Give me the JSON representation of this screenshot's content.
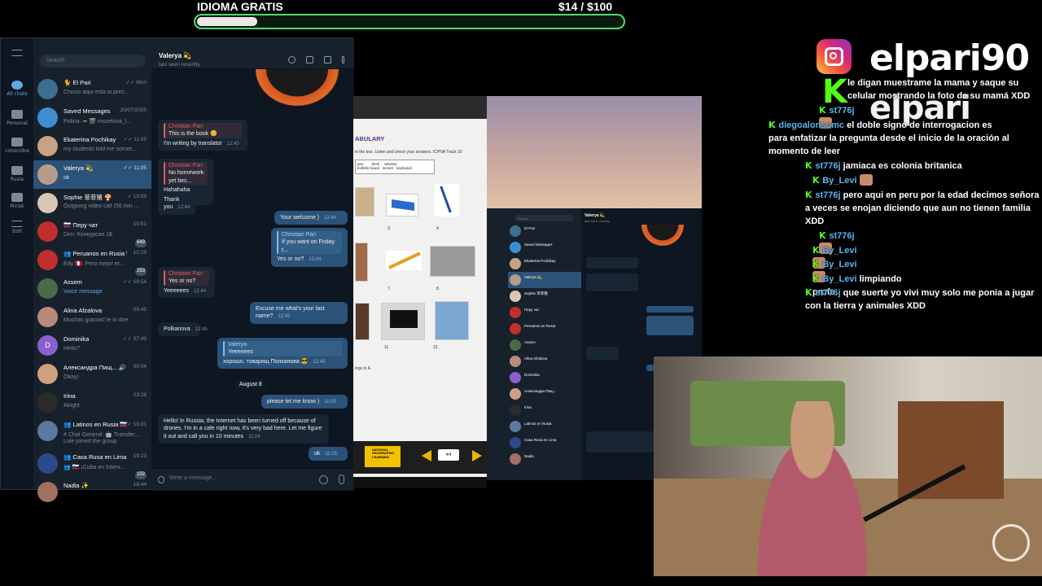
{
  "goal": {
    "title": "IDIOMA GRATIS",
    "amount": "$14  /  $100",
    "progress": 0.14,
    "accent": "#4ee06a"
  },
  "telegram": {
    "rail": [
      {
        "label": "All chats",
        "badge": "17"
      },
      {
        "label": "Personal"
      },
      {
        "label": "conocidos"
      },
      {
        "label": "Rusia"
      },
      {
        "label": "Minsk"
      },
      {
        "label": "Edit"
      }
    ],
    "search_placeholder": "Search",
    "chats": [
      {
        "name": "🐈 El Pari",
        "time": "✓✓ Mon",
        "preview": "Chicos aqui está la prim...",
        "color": "#3b6e8f"
      },
      {
        "name": "Saved Messages",
        "time": "20/07/2025",
        "preview": "Polina: ➡ 🎬 mozelova_l...",
        "color": "#3d8ed0"
      },
      {
        "name": "Ekaterina Pochikay",
        "time": "✓✓ 11:05",
        "preview": "my students told me somet...",
        "color": "#c9a184"
      },
      {
        "name": "Valerya 💫",
        "time": "✓✓ 11:05",
        "preview": "ok",
        "color": "#b89c8a"
      },
      {
        "name": "Sophie 菲菲猪 🍄",
        "time": "✓ 10:59",
        "preview": "Outgoing video call (56 min ...",
        "color": "#d8c6b6"
      },
      {
        "name": "🇷🇺 Перу чат",
        "time": "10:51",
        "preview": "Den: Конкурсия 1$",
        "badge": "649",
        "color": "#c22e2e"
      },
      {
        "name": "👥 Peruanos en Rusia 🇷🇺",
        "time": "10:29",
        "preview": "Edy 🇵🇪: Pero mejor er...",
        "badge": "253",
        "color": "#c22e2e"
      },
      {
        "name": "Assem",
        "time": "✓✓ 09:54",
        "preview": "Voice message",
        "color": "#4a6a4a"
      },
      {
        "name": "Alina Afzalova",
        "time": "09:45",
        "preview": "Muchas gracias! le lo diré",
        "color": "#b88a7a"
      },
      {
        "name": "Dominika",
        "time": "✓✓ 07:49",
        "preview": "Hello?",
        "initial": "D",
        "color": "#8a5fd0"
      },
      {
        "name": "Александра Пищ... 🔊",
        "time": "00:04",
        "preview": "Okay)",
        "color": "#d0a080"
      },
      {
        "name": "Irina",
        "time": "23:28",
        "preview": "Alright",
        "color": "#2b2b2b"
      },
      {
        "name": "👥 Latinos en Rusia 🇷🇺",
        "time": "✓✓ 19:31",
        "preview": "# Chat General: 🤖 Transfer...",
        "sub": "Lole joined the group",
        "color": "#5a7aa0"
      },
      {
        "name": "👥 Casa Rusa en Lima ...",
        "time": "19:23",
        "preview": "👥 🇷🇺 ¡Cuba en Interv...",
        "badge": "102",
        "color": "#2a4a8a"
      },
      {
        "name": "Nadia ✨",
        "time": "18:44",
        "preview": "",
        "color": "#a07060"
      }
    ],
    "conversation": {
      "name": "Valerya 💫",
      "status": "last seen recently",
      "date_pill": "August 8",
      "composer_placeholder": "Write a message...",
      "messages": [
        {
          "dir": "in",
          "quote_name": "Christian Pari",
          "quote_text": "This is the book 😊",
          "text": "I'm writing by translator",
          "time": "12:43"
        },
        {
          "dir": "in",
          "quote_name": "Christian Pari",
          "quote_text": "No homework yet bec...",
          "text": "Hahahaha ok",
          "time": "12:43"
        },
        {
          "dir": "in",
          "text": "Thank you",
          "time": "12:44"
        },
        {
          "dir": "out",
          "text": "Your welcome )",
          "time": "12:44"
        },
        {
          "dir": "out",
          "quote_name": "Christian Pari",
          "quote_text": "If you want on Friday t...",
          "text": "Yes or no?",
          "time": "12:44"
        },
        {
          "dir": "in",
          "quote_name": "Christian Pari",
          "quote_text": "Yes or no?",
          "text": "Yeeeeees",
          "time": "12:44"
        },
        {
          "dir": "out",
          "text": "Excuse me what's your last name?",
          "time": "12:45"
        },
        {
          "dir": "in",
          "text": "Polkanova",
          "time": "12:45"
        },
        {
          "dir": "out",
          "quote_name": "Valerya",
          "quote_text": "Yeeeeees",
          "text": "хорошо, товарищ Полканова 😎",
          "time": "12:45"
        },
        {
          "dir": "out",
          "text": "please let me know )",
          "time": "11:03"
        },
        {
          "dir": "in",
          "text": "Hello! In Russia, the Internet has been turned off because of drones. I'm in a cafe right now, it's very bad here. Let me figure it out and call you in 10 minutes",
          "time": "11:04"
        },
        {
          "dir": "out",
          "text": "ok",
          "time": "11:05"
        }
      ]
    }
  },
  "book": {
    "title": "ABULARY",
    "instructions": "in the box. Listen and check your answers. ICPNA Track 10",
    "box_words": [
      "pen",
      "desk",
      "window",
      "bulletin board",
      "screen",
      "keyboard"
    ],
    "numbers": [
      "3.",
      "4.",
      "7.",
      "8.",
      "11.",
      "12."
    ],
    "footer_text": "ings in A.",
    "publisher": "NATIONAL GEOGRAPHIC LEARNING",
    "page": "4/4"
  },
  "mini_telegram": {
    "search_placeholder": "Search",
    "chats": [
      "El Pari",
      "Saved Messages",
      "Ekaterina Pochikay",
      "Valerya 💫",
      "Sophie 菲菲猪",
      "Перу чат",
      "Peruanos en Rusia",
      "Assem",
      "Alina Afzalova",
      "Dominika",
      "Александра Пищ...",
      "Irina",
      "Latinos en Rusia",
      "Casa Rusa en Lima",
      "Nadia"
    ],
    "conv_name": "Valerya 💫",
    "conv_status": "last seen recently"
  },
  "overlay": {
    "instagram_handle": "elpari90",
    "kick_handle": "elpari",
    "chat": [
      {
        "user": "",
        "text": "le digan muestrame la mama y saque su celular mostrando la foto de su mamá XDD"
      },
      {
        "user": "st776j",
        "text": "",
        "emote": true
      },
      {
        "user": "diegoalonsomc",
        "text": "el doble signo de interrogacion es para enfatizar la pregunta desde el inicio de la oración al momento de leer"
      },
      {
        "user": "st776j",
        "text": "jamiaca es colonia britanica"
      },
      {
        "user": "By_Levi",
        "text": "",
        "emote": true
      },
      {
        "user": "st776j",
        "text": "pero aqui en peru por la edad decimos señora a veces se enojan diciendo que aun no tienen familia XDD"
      },
      {
        "user": "st776j",
        "text": "",
        "emote": true
      },
      {
        "user": "By_Levi",
        "text": "",
        "emote": true
      },
      {
        "user": "By_Levi",
        "text": "",
        "emote": true
      },
      {
        "user": "By_Levi",
        "text": "limpiando profe"
      },
      {
        "user": "st776j",
        "text": "que suerte yo vivi muy solo me ponia a jugar con la tierra y animales XDD"
      }
    ],
    "kick_color": "#53fc18",
    "user_color": "#5ab4f0"
  }
}
